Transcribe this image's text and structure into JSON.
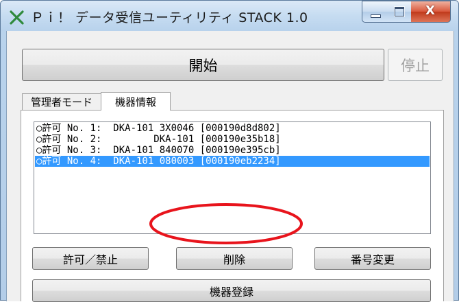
{
  "window": {
    "title": "Ｐｉ！ データ受信ユーティリティ STACK 1.0",
    "controls": {
      "minimize": "minimize",
      "maximize": "maximize",
      "close": "X"
    }
  },
  "toolbar": {
    "start_label": "開始",
    "stop_label": "停止"
  },
  "tabs": [
    {
      "label": "管理者モード",
      "active": false
    },
    {
      "label": "機器情報",
      "active": true
    }
  ],
  "device_list": {
    "items": [
      {
        "text": "○許可 No. 1:  DKA-101 3X0046 [000190d8d802]",
        "selected": false
      },
      {
        "text": "○許可 No. 2:         DKA-101 [000190e35b18]",
        "selected": false
      },
      {
        "text": "○許可 No. 3:  DKA-101 840070 [000190e395cb]",
        "selected": false
      },
      {
        "text": "○許可 No. 4:  DKA-101 080003 [000190eb2234]",
        "selected": true
      }
    ]
  },
  "actions": {
    "permit_label": "許可／禁止",
    "delete_label": "削除",
    "renumber_label": "番号変更",
    "register_label": "機器登録"
  },
  "colors": {
    "selection": "#3399ff",
    "annotation": "#e8141c",
    "close_button": "#c0391a"
  },
  "icons": {
    "app": "app-x-icon"
  }
}
